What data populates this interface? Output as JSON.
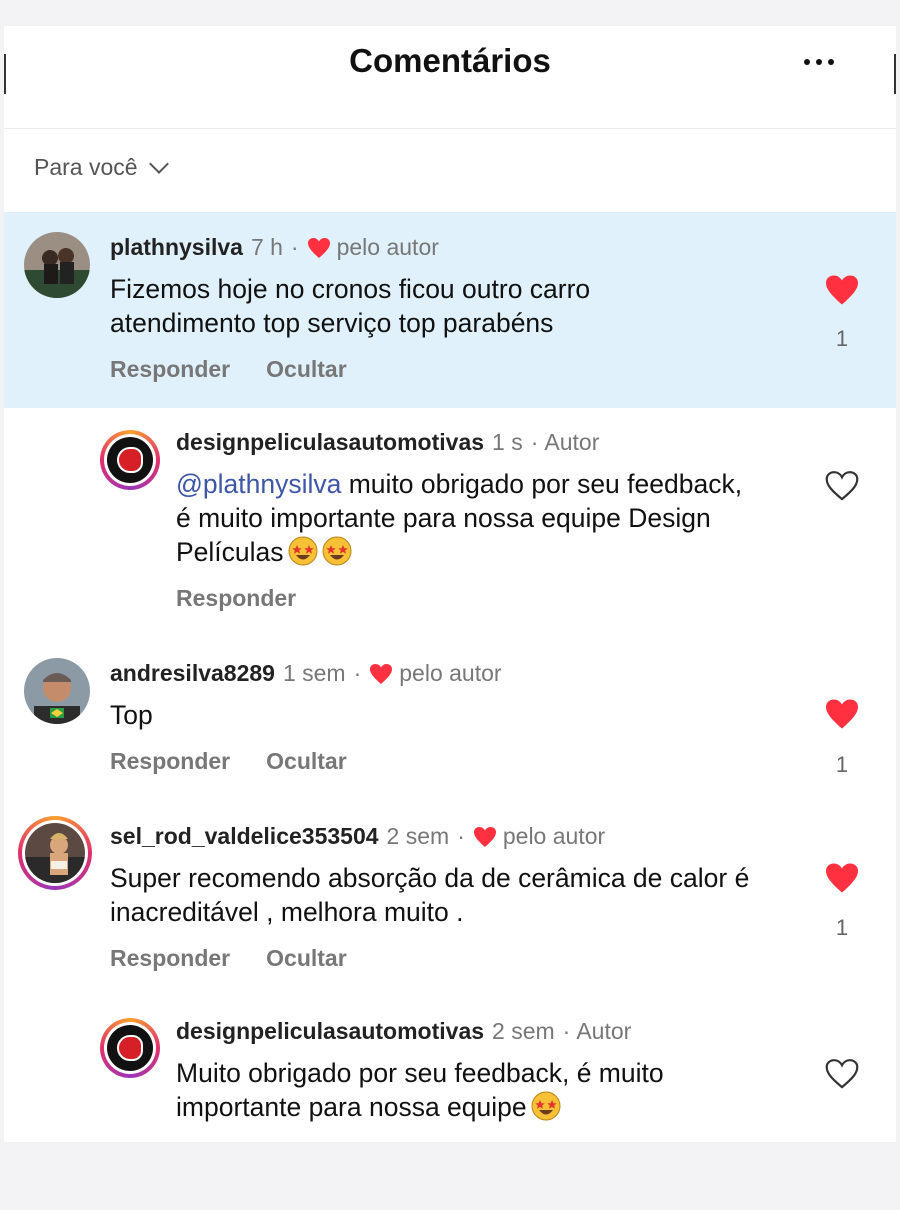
{
  "header": {
    "title": "Comentários",
    "more_icon": "more-horizontal-icon"
  },
  "filter": {
    "label": "Para você",
    "icon": "chevron-down-icon"
  },
  "colors": {
    "highlight": "#e0f1fb",
    "heart": "#ff3040",
    "mention": "#3d56a8"
  },
  "comments": [
    {
      "username": "plathnysilva",
      "time": "7 h",
      "tag": "pelo autor",
      "text": "Fizemos hoje no cronos ficou outro carro atendimento top serviço top parabéns",
      "actions": [
        "Responder",
        "Ocultar"
      ],
      "likes": "1",
      "liked": true
    },
    {
      "username": "designpeliculasautomotivas",
      "time": "1 s",
      "tag": "Autor",
      "mention": "@plathnysilva",
      "text": " muito obrigado por seu feedback, é muito importante para nossa equipe Design Películas",
      "actions": [
        "Responder"
      ],
      "liked": false
    },
    {
      "username": "andresilva8289",
      "time": "1 sem",
      "tag": "pelo autor",
      "text": "Top",
      "actions": [
        "Responder",
        "Ocultar"
      ],
      "likes": "1",
      "liked": true
    },
    {
      "username": "sel_rod_valdelice353504",
      "time": "2 sem",
      "tag": "pelo autor",
      "text": "Super recomendo absorção da de cerâmica  de calor é inacreditável , melhora muito .",
      "actions": [
        "Responder",
        "Ocultar"
      ],
      "likes": "1",
      "liked": true
    },
    {
      "username": "designpeliculasautomotivas",
      "time": "2 sem",
      "tag": "Autor",
      "text": "Muito obrigado por seu feedback, é muito importante para nossa equipe",
      "liked": false
    }
  ]
}
